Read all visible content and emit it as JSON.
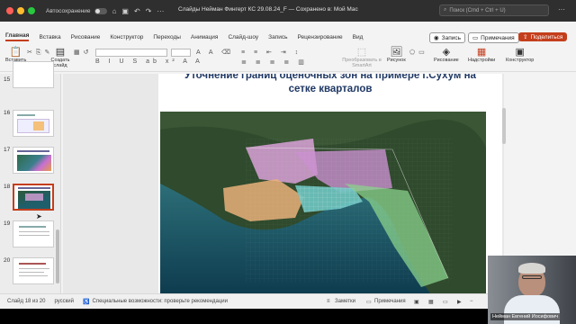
{
  "titlebar": {
    "autosave_label": "Автосохранение",
    "doc_title": "Слайды Нейман Фингерт КС 29.08.24_F — Сохранено в: Мой Mac",
    "search_placeholder": "Поиск (Cmd + Ctrl + U)"
  },
  "ribbon": {
    "tabs": [
      "Главная",
      "Вставка",
      "Рисование",
      "Конструктор",
      "Переходы",
      "Анимация",
      "Слайд-шоу",
      "Запись",
      "Рецензирование",
      "Вид"
    ],
    "record_label": "Запись",
    "notes_label": "Примечания",
    "share_label": "Поделиться",
    "tools": {
      "paste": "Вставить",
      "new_slide": "Создать слайд",
      "smartart": "Преобразовать в SmartArt",
      "picture": "Рисунок",
      "drawing": "Рисование",
      "addins": "Надстройки",
      "designer": "Конструктор"
    }
  },
  "thumbnails": {
    "numbers": [
      "15",
      "16",
      "17",
      "18",
      "19",
      "20"
    ],
    "selected": "18"
  },
  "slide": {
    "title_line1": "Уточнение границ оценочных зон на примере г.Сухум на",
    "title_line2": "сетке кварталов"
  },
  "statusbar": {
    "slide_counter": "Слайд 18 из 20",
    "language": "русский",
    "accessibility": "Специальные возможности: проверьте рекомендации",
    "notes": "Заметки",
    "comments": "Примечания"
  },
  "webcam": {
    "name": "Нейман Евгений Иосифович"
  },
  "colors": {
    "accent": "#c43e1c",
    "title_color": "#1f3864"
  }
}
